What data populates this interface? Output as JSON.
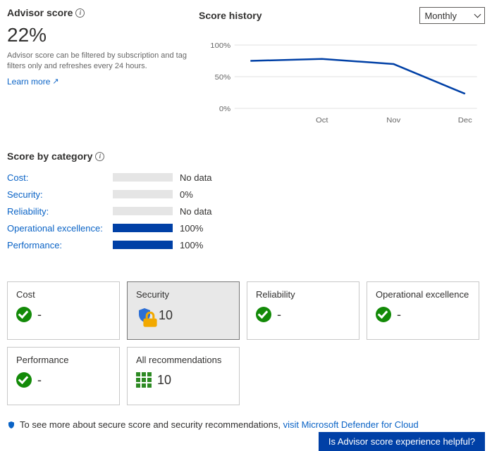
{
  "advisor": {
    "heading": "Advisor score",
    "score_display": "22%",
    "help_text": "Advisor score can be filtered by subscription and tag filters only and refreshes every 24 hours.",
    "learn_more": "Learn more"
  },
  "history": {
    "heading": "Score history",
    "range_selected": "Monthly"
  },
  "chart_data": {
    "type": "line",
    "title": "Score history",
    "ylabel": "",
    "ylim": [
      0,
      100
    ],
    "yticks": [
      "0%",
      "50%",
      "100%"
    ],
    "categories": [
      "",
      "Oct",
      "Nov",
      "Dec"
    ],
    "series": [
      {
        "name": "Advisor score",
        "values": [
          75,
          78,
          70,
          23
        ]
      }
    ]
  },
  "categories": {
    "heading": "Score by category",
    "rows": [
      {
        "label": "Cost:",
        "pct": 0,
        "value_text": "No data"
      },
      {
        "label": "Security:",
        "pct": 0,
        "value_text": "0%"
      },
      {
        "label": "Reliability:",
        "pct": 0,
        "value_text": "No data"
      },
      {
        "label": "Operational excellence:",
        "pct": 100,
        "value_text": "100%"
      },
      {
        "label": "Performance:",
        "pct": 100,
        "value_text": "100%"
      }
    ]
  },
  "tiles": [
    {
      "title": "Cost",
      "value": "-",
      "icon": "check",
      "selected": false
    },
    {
      "title": "Security",
      "value": "10",
      "icon": "shield",
      "selected": true
    },
    {
      "title": "Reliability",
      "value": "-",
      "icon": "check",
      "selected": false
    },
    {
      "title": "Operational excellence",
      "value": "-",
      "icon": "check",
      "selected": false
    },
    {
      "title": "Performance",
      "value": "-",
      "icon": "check",
      "selected": false
    },
    {
      "title": "All recommendations",
      "value": "10",
      "icon": "grid",
      "selected": false
    }
  ],
  "footer": {
    "prefix": "To see more about secure score and security recommendations, ",
    "link_text": "visit Microsoft Defender for Cloud"
  },
  "feedback": {
    "text": "Is Advisor score experience helpful?"
  }
}
